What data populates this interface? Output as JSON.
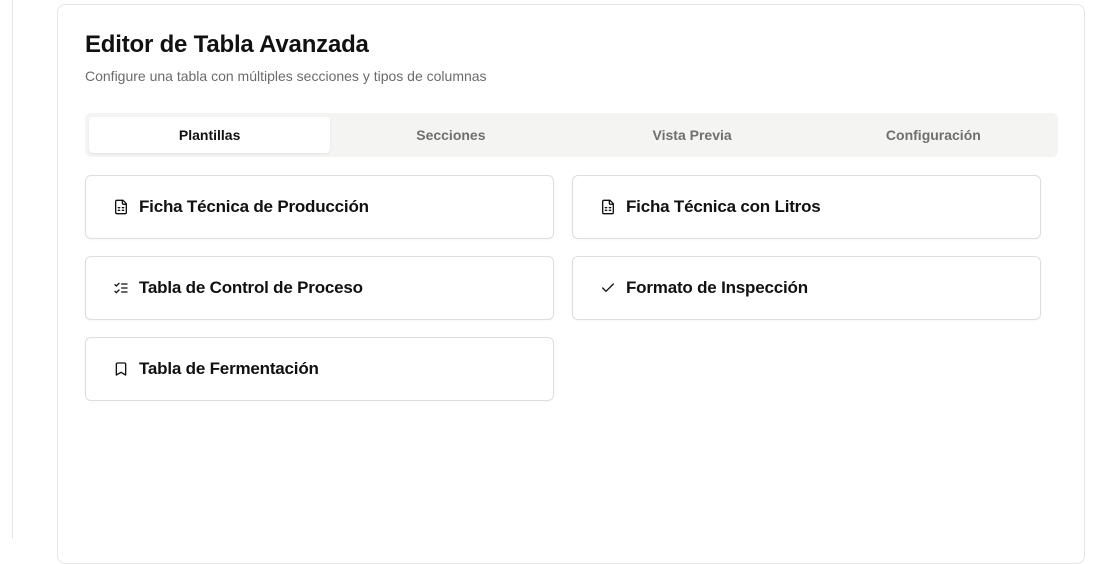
{
  "editor": {
    "title": "Editor de Tabla Avanzada",
    "subtitle": "Configure una tabla con múltiples secciones y tipos de columnas"
  },
  "tabs": [
    {
      "label": "Plantillas",
      "active": true
    },
    {
      "label": "Secciones",
      "active": false
    },
    {
      "label": "Vista Previa",
      "active": false
    },
    {
      "label": "Configuración",
      "active": false
    }
  ],
  "templates": [
    {
      "label": "Ficha Técnica de Producción",
      "icon": "file-spreadsheet-icon"
    },
    {
      "label": "Ficha Técnica con Litros",
      "icon": "file-spreadsheet-icon"
    },
    {
      "label": "Tabla de Control de Proceso",
      "icon": "list-checks-icon"
    },
    {
      "label": "Formato de Inspección",
      "icon": "check-icon"
    },
    {
      "label": "Tabla de Fermentación",
      "icon": "bookmark-icon"
    }
  ],
  "colors": {
    "tab_bar_background": "#f4f4f3",
    "text_primary": "#111111",
    "text_muted": "#6b6b6b",
    "border": "#dedede"
  }
}
